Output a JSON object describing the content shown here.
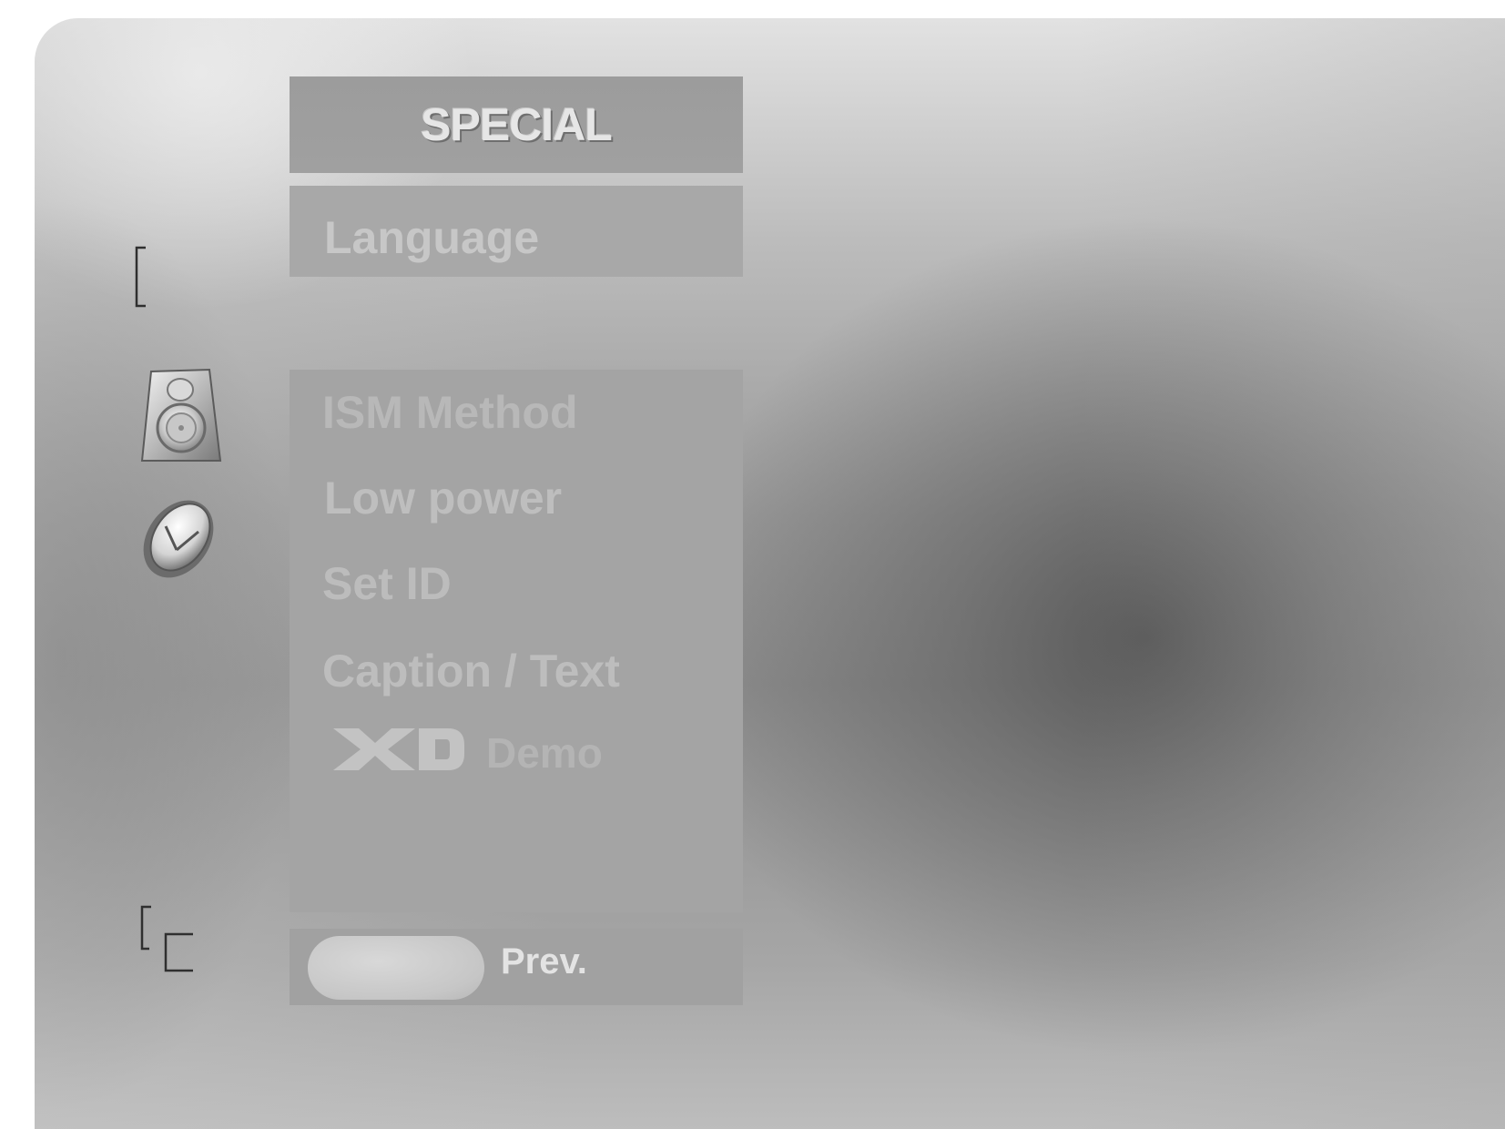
{
  "menu": {
    "title": "SPECIAL",
    "language_label": "Language",
    "items": [
      {
        "label": "ISM Method"
      },
      {
        "label": "Low power"
      },
      {
        "label": "Set ID"
      },
      {
        "label": "Caption / Text"
      }
    ],
    "xd_logo_text": "XD",
    "demo_label": "Demo"
  },
  "footer": {
    "prev_label": "Prev."
  },
  "side_icons": [
    {
      "name": "bracket-marker-icon"
    },
    {
      "name": "speaker-icon"
    },
    {
      "name": "clock-icon"
    },
    {
      "name": "corner-brackets-icon"
    }
  ]
}
